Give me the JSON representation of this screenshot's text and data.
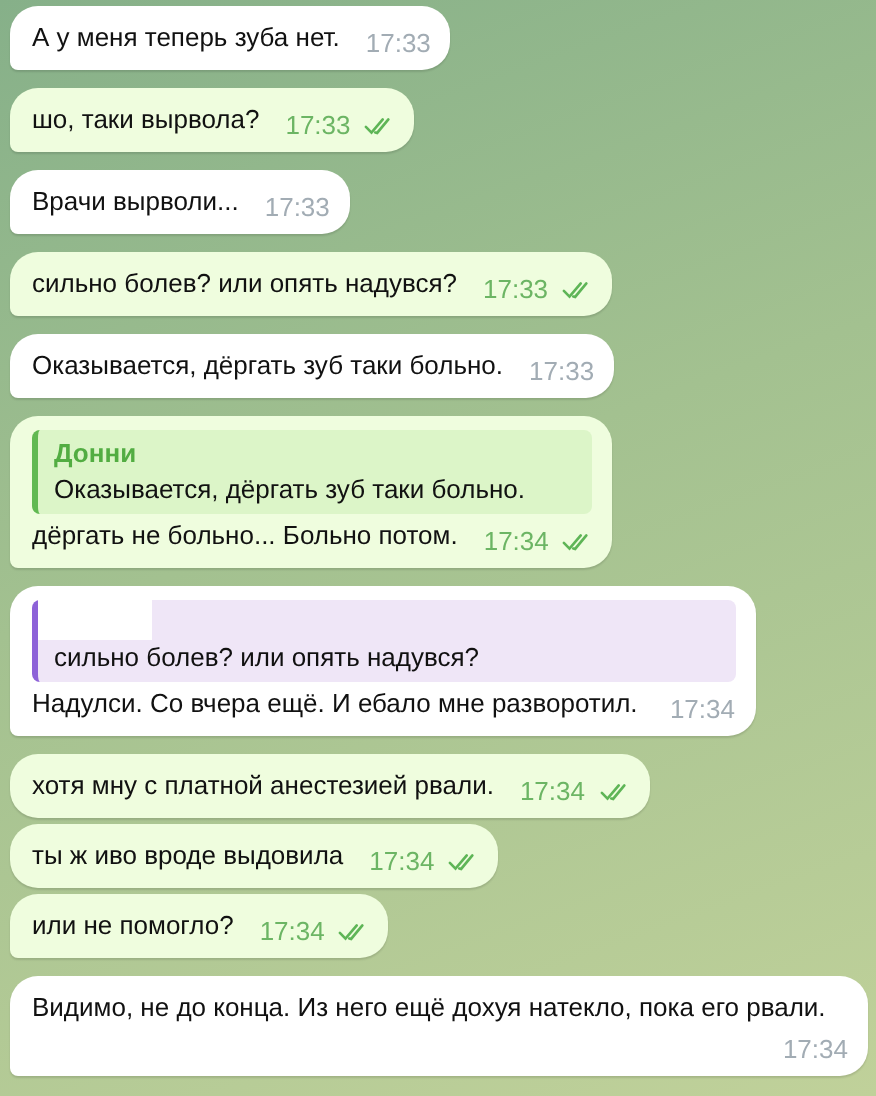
{
  "messages": [
    {
      "kind": "incoming",
      "text": "А у меня теперь зуба нет.",
      "time": "17:33"
    },
    {
      "kind": "outgoing",
      "text": "шо, таки вырвола?",
      "time": "17:33",
      "read": true
    },
    {
      "kind": "incoming",
      "text": "Врачи вырволи...",
      "time": "17:33"
    },
    {
      "kind": "outgoing",
      "text": "сильно болев? или опять надувся?",
      "time": "17:33",
      "read": true
    },
    {
      "kind": "incoming",
      "text": "Оказывается, дёргать зуб таки больно.",
      "time": "17:33"
    },
    {
      "kind": "outgoing",
      "reply": {
        "author": "Донни",
        "text": "Оказывается, дёргать зуб таки больно."
      },
      "text": "дёргать не больно... Больно потом.",
      "time": "17:34",
      "read": true
    },
    {
      "kind": "incoming",
      "reply": {
        "author_redacted": true,
        "text": "сильно болев? или опять надувся?"
      },
      "text": "Надулси. Со вчера ещё. И ебало мне разворотил.",
      "time": "17:34"
    },
    {
      "kind": "outgoing",
      "text": "хотя мну с платной анестезией рвали.",
      "time": "17:34",
      "read": true
    },
    {
      "kind": "outgoing",
      "text": "ты ж иво вроде выдовила",
      "time": "17:34",
      "read": true
    },
    {
      "kind": "outgoing",
      "text": "или не помогло?",
      "time": "17:34",
      "read": true
    },
    {
      "kind": "incoming",
      "text": "Видимо, не до конца. Из него ещё дохуя натекло, пока его рвали.",
      "time": "17:34"
    }
  ]
}
